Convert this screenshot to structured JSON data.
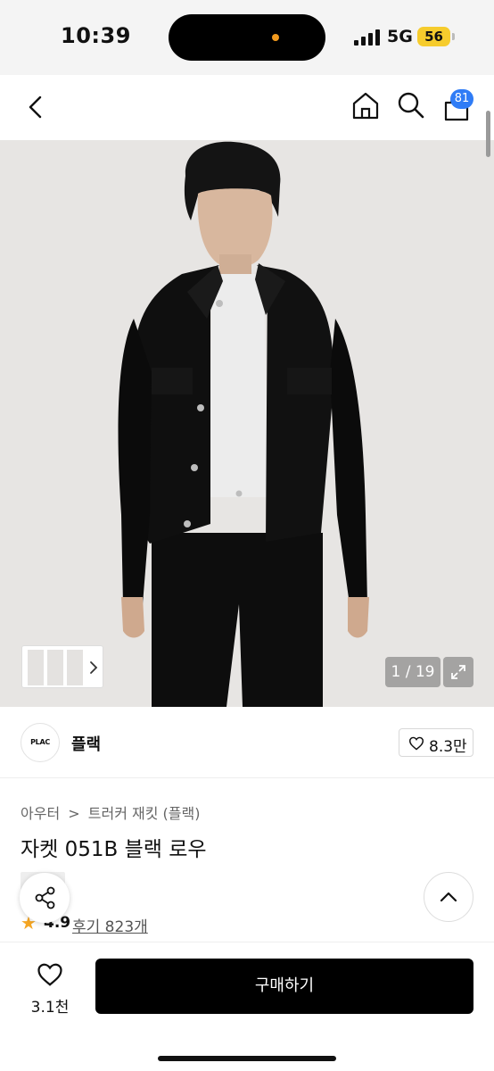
{
  "status_bar": {
    "time": "10:39",
    "network": "5G",
    "battery": "56"
  },
  "nav": {
    "cart_count": "81",
    "icons": [
      "back-icon",
      "home-icon",
      "search-icon",
      "cart-icon"
    ]
  },
  "gallery": {
    "counter": "1 / 19",
    "thumbnail_chevron_icon": "chevron-right-icon",
    "expand_icon": "expand-icon"
  },
  "brand": {
    "logo_text": "PLAC",
    "name": "플랙",
    "likes": "8.3만"
  },
  "product": {
    "category": "아우터",
    "breadcrumb_separator": ">",
    "subcategory": "트러커 재킷 (플랙)",
    "title": "자켓 051B 블랙 로우",
    "rating": "4.9",
    "reviews": "후기 823개"
  },
  "bottom_bar": {
    "wish_count": "3.1천",
    "buy_label": "구매하기"
  },
  "colors": {
    "accent_badge": "#2f7cf6",
    "battery": "#f6cc2d",
    "star": "#f5a623",
    "buy_button": "#000000"
  }
}
